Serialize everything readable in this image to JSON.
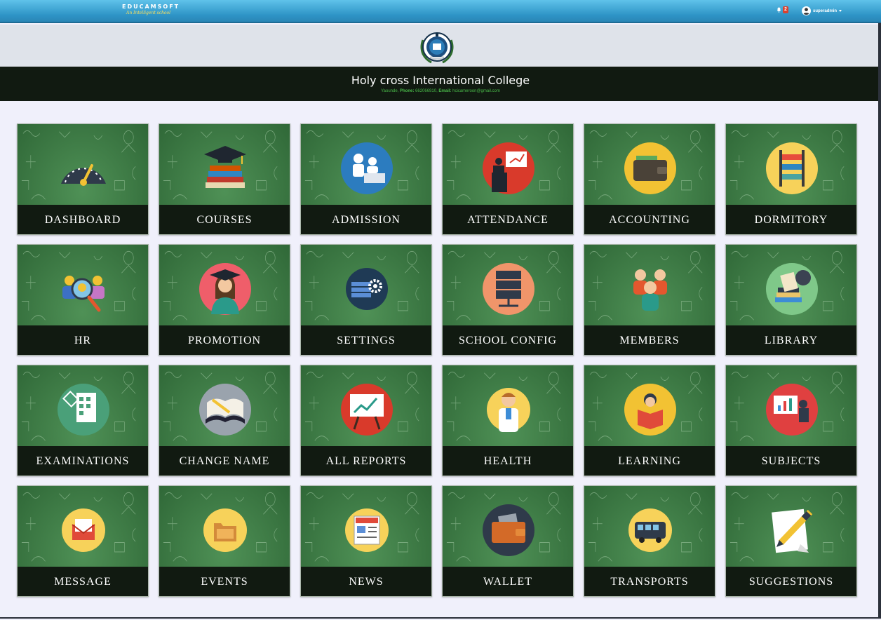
{
  "header": {
    "brand_name": "EDUCAMSOFT",
    "brand_tagline": "An Intelligent school",
    "notification_count": "2",
    "user_name": "superadmin"
  },
  "school": {
    "name": "Holy cross International College",
    "city": "Yaounde",
    "phone_label": "Phone:",
    "phone": "662066910",
    "email_label": "Email:",
    "email": "hcicameroon@gmail.com"
  },
  "colors": {
    "topbar": "#2e94c6",
    "tile_bg": "#3e7c45",
    "label_bar": "#111a11",
    "page_bg": "#f0f0fb"
  },
  "modules": [
    {
      "label": "DASHBOARD",
      "icon": "gauge-icon"
    },
    {
      "label": "COURSES",
      "icon": "graduation-cap-books-icon"
    },
    {
      "label": "ADMISSION",
      "icon": "admission-desk-icon"
    },
    {
      "label": "ATTENDANCE",
      "icon": "presentation-podium-icon"
    },
    {
      "label": "ACCOUNTING",
      "icon": "wallet-icon"
    },
    {
      "label": "DORMITORY",
      "icon": "bunk-bed-icon"
    },
    {
      "label": "HR",
      "icon": "people-search-icon"
    },
    {
      "label": "PROMOTION",
      "icon": "graduate-woman-icon"
    },
    {
      "label": "SETTINGS",
      "icon": "server-gear-icon"
    },
    {
      "label": "SCHOOL CONFIG",
      "icon": "server-rack-icon"
    },
    {
      "label": "MEMBERS",
      "icon": "group-people-icon"
    },
    {
      "label": "LIBRARY",
      "icon": "books-globe-icon"
    },
    {
      "label": "EXAMINATIONS",
      "icon": "exam-sheet-icon"
    },
    {
      "label": "CHANGE NAME",
      "icon": "book-pen-icon"
    },
    {
      "label": "ALL REPORTS",
      "icon": "report-chart-icon"
    },
    {
      "label": "HEALTH",
      "icon": "doctor-icon"
    },
    {
      "label": "LEARNING",
      "icon": "reading-student-icon"
    },
    {
      "label": "SUBJECTS",
      "icon": "teacher-board-icon"
    },
    {
      "label": "MESSAGE",
      "icon": "envelope-icon"
    },
    {
      "label": "EVENTS",
      "icon": "folder-icon"
    },
    {
      "label": "NEWS",
      "icon": "newspaper-icon"
    },
    {
      "label": "WALLET",
      "icon": "wallet-card-icon"
    },
    {
      "label": "TRANSPORTS",
      "icon": "bus-icon"
    },
    {
      "label": "SUGGESTIONS",
      "icon": "pencil-paper-icon"
    }
  ]
}
